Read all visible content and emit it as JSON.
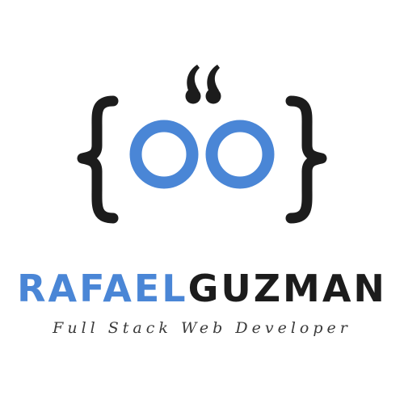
{
  "brand": {
    "first_name": "RAFAEL",
    "last_name": "GUZMAN",
    "tagline": "Full Stack Web Developer"
  },
  "colors": {
    "accent": "#4a86d6",
    "ink": "#1c1c1c",
    "background": "#ffffff"
  },
  "icons": [
    "curly-brace-left-icon",
    "quote-mark-icon",
    "ring-icon",
    "curly-brace-right-icon"
  ]
}
